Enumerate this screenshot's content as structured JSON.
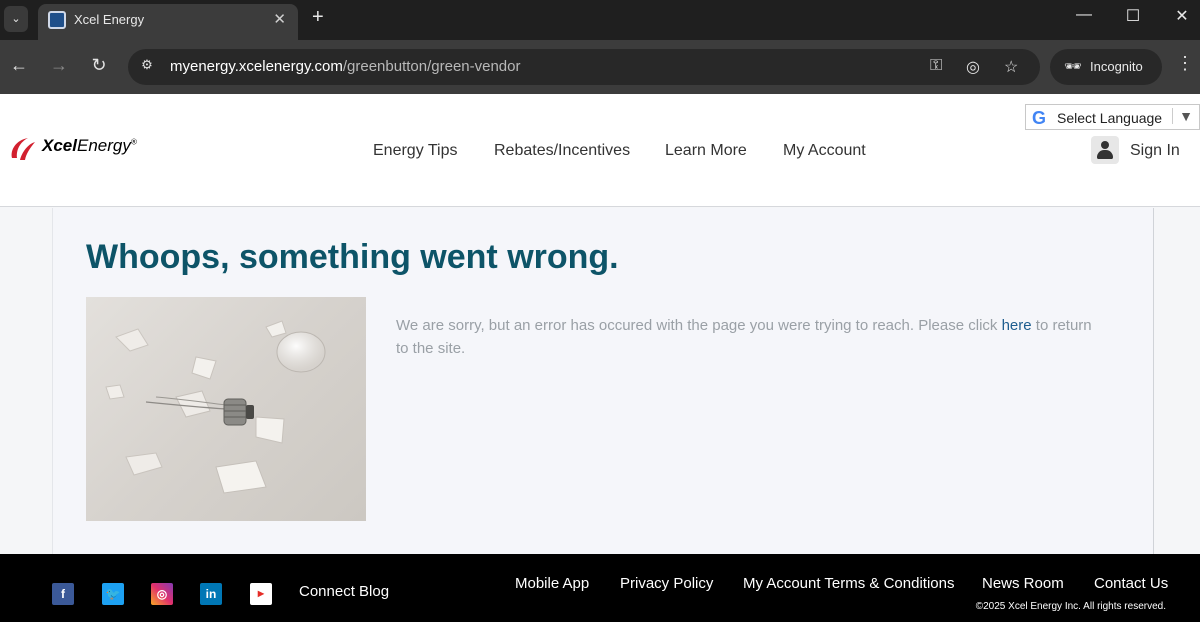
{
  "browser": {
    "tab_title": "Xcel Energy",
    "url_host": "myenergy.xcelenergy.com",
    "url_path": "/greenbutton/green-vendor",
    "incognito_label": "Incognito"
  },
  "header": {
    "logo_bold": "Xcel",
    "logo_rest": "Energy",
    "logo_mark": "®",
    "language_label": "Select Language",
    "nav": {
      "energy_tips": "Energy Tips",
      "rebates": "Rebates/Incentives",
      "learn_more": "Learn More",
      "my_account": "My Account"
    },
    "sign_in": "Sign In"
  },
  "main": {
    "title": "Whoops, something went wrong.",
    "message_before": "We are sorry, but an error has occured with the page you were trying to reach. Please click ",
    "message_link": "here",
    "message_after": " to return to the site.",
    "image_alt": "broken light bulb"
  },
  "footer": {
    "connect_blog": "Connect Blog",
    "links": {
      "mobile_app": "Mobile App",
      "privacy_policy": "Privacy Policy",
      "terms": "My Account Terms & Conditions",
      "news_room": "News Room",
      "contact_us": "Contact Us"
    },
    "copyright": "©2025 Xcel Energy Inc. All rights reserved."
  },
  "colors": {
    "title_teal": "#0d5468",
    "link_blue": "#1d5d8f",
    "logo_red": "#d2202f",
    "facebook": "#3b5998",
    "twitter": "#1da1f2",
    "linkedin": "#0077b5",
    "youtube_red": "#e52d27"
  }
}
